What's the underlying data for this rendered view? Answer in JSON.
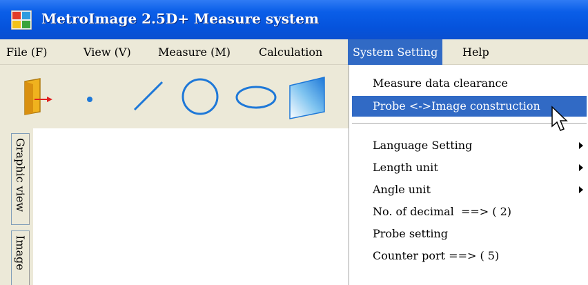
{
  "window": {
    "title": "MetroImage 2.5D+ Measure system"
  },
  "menubar": {
    "items": [
      {
        "label": "File (F)"
      },
      {
        "label": "View (V)"
      },
      {
        "label": "Measure (M)"
      },
      {
        "label": "Calculation"
      },
      {
        "label": "System Setting"
      },
      {
        "label": "Help"
      }
    ]
  },
  "toolbar": {
    "tools": [
      "open-file-icon",
      "point-icon",
      "line-icon",
      "circle-icon",
      "ellipse-icon",
      "plane-icon"
    ]
  },
  "side_tabs": [
    {
      "label": "Graphic view"
    },
    {
      "label": "Image"
    }
  ],
  "dropdown": {
    "items": [
      {
        "label": "Measure data clearance",
        "submenu": false,
        "highlighted": false
      },
      {
        "label": "Probe <->Image construction",
        "submenu": false,
        "highlighted": true
      },
      {
        "label": "Language Setting",
        "submenu": true,
        "highlighted": false
      },
      {
        "label": "Length unit",
        "submenu": true,
        "highlighted": false
      },
      {
        "label": "Angle unit",
        "submenu": true,
        "highlighted": false
      },
      {
        "label": "No. of decimal  ==> ( 2)",
        "submenu": false,
        "highlighted": false
      },
      {
        "label": "Probe setting",
        "submenu": false,
        "highlighted": false
      },
      {
        "label": "Counter port ==> ( 5)",
        "submenu": false,
        "highlighted": false
      }
    ]
  },
  "colors": {
    "titlebar": "#0553dc",
    "menu_highlight": "#316ac5",
    "toolbar_bg": "#ece9d8",
    "shape_blue": "#1e78d8"
  }
}
